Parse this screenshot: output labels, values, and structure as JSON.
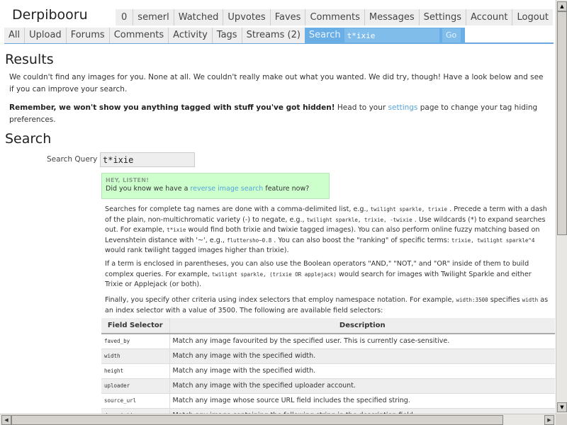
{
  "site": {
    "logo": "Derpibooru"
  },
  "user_nav": [
    {
      "label": "0"
    },
    {
      "label": "semerl"
    },
    {
      "label": "Watched"
    },
    {
      "label": "Upvotes"
    },
    {
      "label": "Faves"
    },
    {
      "label": "Comments"
    },
    {
      "label": "Messages"
    },
    {
      "label": "Settings"
    },
    {
      "label": "Account"
    },
    {
      "label": "Logout"
    }
  ],
  "main_nav": [
    {
      "label": "All"
    },
    {
      "label": "Upload"
    },
    {
      "label": "Forums"
    },
    {
      "label": "Comments"
    },
    {
      "label": "Activity"
    },
    {
      "label": "Tags"
    },
    {
      "label": "Streams (2)"
    }
  ],
  "search_bar": {
    "label": "Search",
    "value": "t*ixie",
    "go": "Go"
  },
  "results": {
    "title": "Results",
    "no_results": "We couldn't find any images for you. None at all. We couldn't really make out what you wanted. We did try, though! Have a look below and see if you can improve your search.",
    "reminder_bold": "Remember, we won't show you anything tagged with stuff you've got hidden!",
    "reminder_pre": " Head to your ",
    "reminder_link": "settings",
    "reminder_post": " page to change your tag hiding preferences."
  },
  "search": {
    "title": "Search",
    "query_label": "Search Query",
    "query_value": "t*ixie",
    "notice": {
      "heading": "HEY, LISTEN!",
      "pre": "Did you know we have a ",
      "link": "reverse image search",
      "post": " feature now?"
    },
    "help1": {
      "t1": "Searches for complete tag names are done with a comma-delimited list, e.g.,",
      "c1": "twilight sparkle, trixie",
      "t2": ". Precede a term with a dash of the plain, non-multichromatic variety (-) to negate, e.g.,",
      "c2": "twilight sparkle, trixie, -twixie",
      "t3": ". Use wildcards (*) to expand searches out. For example,",
      "c3": "t*ixie",
      "t4": "would find both trixie and twixie tagged images). You can also perform online fuzzy matching based on Levenshtein distance with '~', e.g.,",
      "c4": "fluttersho~0.8",
      "t5": ". You can also boost the \"ranking\" of specific terms:",
      "c5": "trixie, twilight sparkle^4",
      "t6": "would rank twilight tagged images higher than trixie)."
    },
    "help2": {
      "t1": "If a term is enclosed in parentheses, you can also use the Boolean operators \"AND,\" \"NOT,\" and \"OR\" inside of them to build complex queries. For example,",
      "c1": "twilight sparkle, (trixie OR applejack)",
      "t2": "would search for images with Twilight Sparkle and either Trixie or Applejack (or both)."
    },
    "help3": {
      "t1": "Finally, you specify other criteria using index selectors that employ namespace notation. For example,",
      "c1": "width:3500",
      "t2": "specifies",
      "c2": "width",
      "t3": "as an index selector with a value of 3500. The following are available field selectors:"
    },
    "table": {
      "headers": [
        "Field Selector",
        "Description"
      ],
      "rows": [
        {
          "field": "faved_by",
          "desc": "Match any image favourited by the specified user. This is currently case-sensitive."
        },
        {
          "field": "width",
          "desc": "Match any image with the specified width."
        },
        {
          "field": "height",
          "desc": "Match any image with the specified width."
        },
        {
          "field": "uploader",
          "desc": "Match any image with the specified uploader account."
        },
        {
          "field": "source_url",
          "desc": "Match any image whose source URL field includes the specified string."
        },
        {
          "field": "description",
          "desc": "Match any image containing the following string in the description field."
        }
      ]
    }
  }
}
